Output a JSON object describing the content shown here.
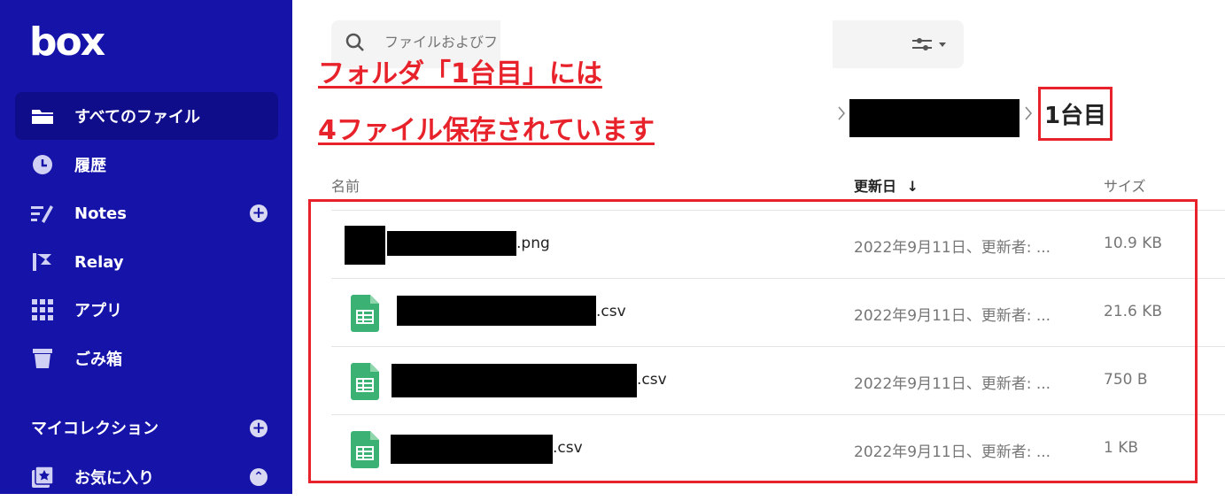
{
  "app": {
    "logo_text": "box"
  },
  "sidebar": {
    "items": [
      {
        "label": "すべてのファイル",
        "icon": "folder-icon"
      },
      {
        "label": "履歴",
        "icon": "clock-icon"
      },
      {
        "label": "Notes",
        "icon": "notes-icon"
      },
      {
        "label": "Relay",
        "icon": "relay-icon"
      },
      {
        "label": "アプリ",
        "icon": "apps-grid-icon"
      },
      {
        "label": "ごみ箱",
        "icon": "trash-icon"
      }
    ],
    "section_title": "マイコレクション",
    "favorites_label": "お気に入り"
  },
  "search": {
    "placeholder": "ファイルおよびフォルダを検索"
  },
  "annotation": {
    "line1": "フォルダ「1台目」には",
    "line2": "4ファイル保存されています"
  },
  "breadcrumb": {
    "current": "1台目"
  },
  "table": {
    "headers": {
      "name": "名前",
      "updated": "更新日",
      "size": "サイズ"
    },
    "rows": [
      {
        "name_suffix": ".png",
        "updated": "2022年9月11日、更新者: ...",
        "size": "10.9 KB",
        "icon": "image-file-icon"
      },
      {
        "name_suffix": ".csv",
        "updated": "2022年9月11日、更新者: ...",
        "size": "21.6 KB",
        "icon": "spreadsheet-icon"
      },
      {
        "name_suffix": ".csv",
        "updated": "2022年9月11日、更新者: ...",
        "size": "750 B",
        "icon": "spreadsheet-icon"
      },
      {
        "name_suffix": ".csv",
        "updated": "2022年9月11日、更新者: ...",
        "size": "1 KB",
        "icon": "spreadsheet-icon"
      }
    ]
  },
  "colors": {
    "sidebar": "#1513a8",
    "annotation_red": "#e8222b",
    "sheet_green": "#3bb273"
  }
}
